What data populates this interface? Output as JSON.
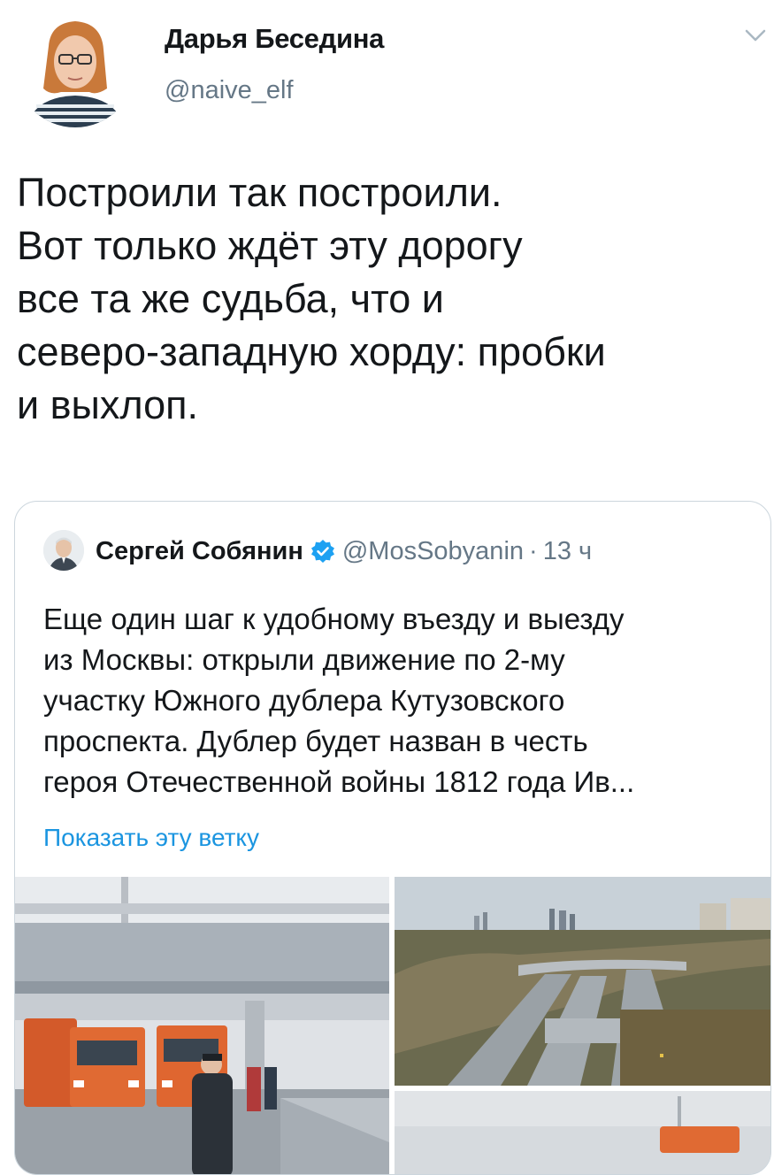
{
  "author": {
    "name": "Дарья Беседина",
    "handle": "@naive_elf"
  },
  "tweet": {
    "lines": [
      "Построили так построили.",
      "Вот только ждёт эту дорогу",
      "все та же судьба, что и",
      "северо-западную хорду: пробки",
      "и выхлоп."
    ]
  },
  "quoted": {
    "name": "Сергей Собянин",
    "handle": "@MosSobyanin",
    "separator": "·",
    "time": "13 ч",
    "lines": [
      "Еще один шаг к удобному въезду и выезду",
      "из Москвы: открыли движение по 2-му",
      "участку Южного дублера Кутузовского",
      "проспекта. Дублер будет назван в честь",
      "героя Отечественной войны 1812 года Ив..."
    ],
    "show_thread": "Показать эту ветку"
  },
  "icons": {
    "menu": "chevron-down-icon",
    "verified": "verified-badge-icon"
  },
  "colors": {
    "text": "#14171a",
    "secondary": "#657786",
    "link": "#1b95e0",
    "verified": "#1da1f2",
    "border": "#ccd6dd"
  }
}
